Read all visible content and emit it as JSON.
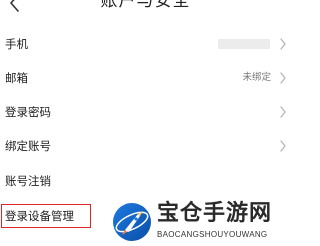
{
  "header": {
    "title": "账户与安全",
    "back_icon": "chevron-left-icon"
  },
  "settings": {
    "phone": {
      "label": "手机",
      "value_masked": true,
      "chevron": "chevron-right-icon"
    },
    "email": {
      "label": "邮箱",
      "value": "未绑定",
      "chevron": "chevron-right-icon"
    },
    "login_password": {
      "label": "登录密码",
      "chevron": "chevron-right-icon"
    },
    "bind_account": {
      "label": "绑定账号",
      "chevron": "chevron-right-icon"
    },
    "account_cancel": {
      "label": "账号注销"
    },
    "login_device_manage": {
      "label": "登录设备管理",
      "highlight_color": "#e02424"
    }
  },
  "watermark": {
    "name": "宝仓手游网",
    "domain": "BAOCANGSHOUYOUWANG",
    "logo_icon": "rocket-logo-icon"
  }
}
